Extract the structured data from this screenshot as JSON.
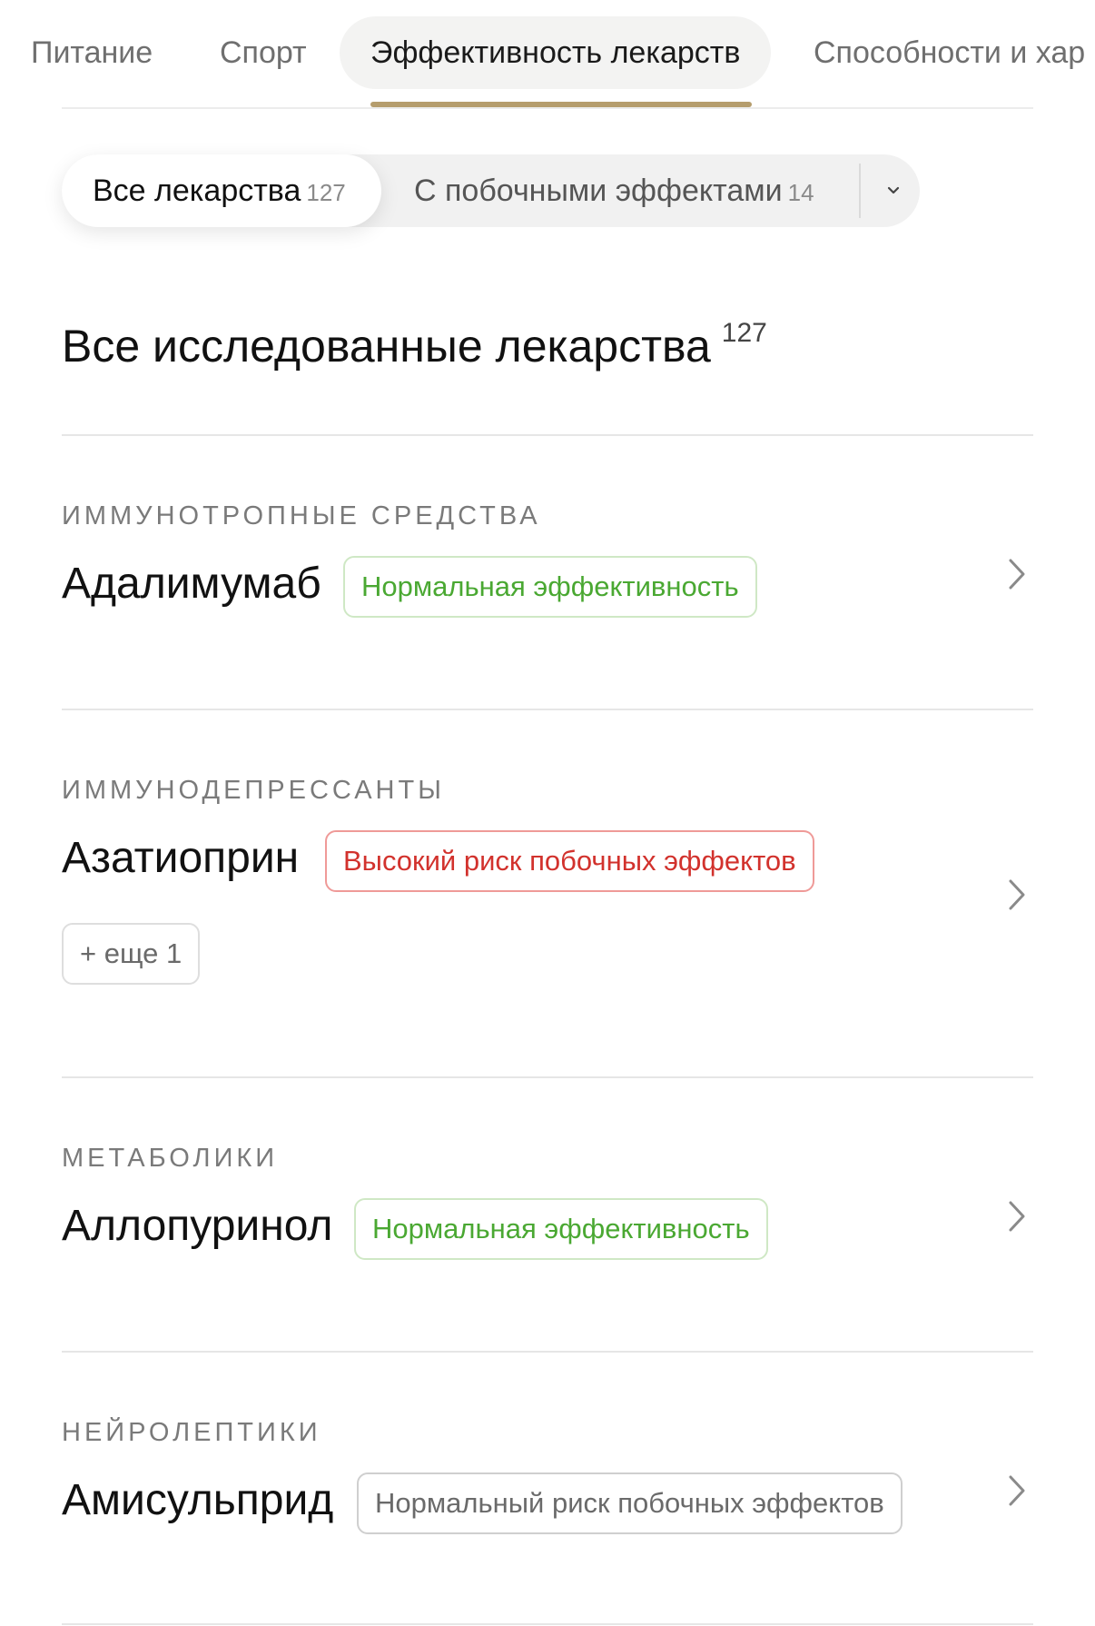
{
  "tabs": [
    {
      "label": "Питание",
      "active": false
    },
    {
      "label": "Спорт",
      "active": false
    },
    {
      "label": "Эффективность лекарств",
      "active": true
    },
    {
      "label": "Способности и хар",
      "active": false
    }
  ],
  "filter": {
    "all": {
      "label": "Все лекарства",
      "count": "127"
    },
    "side_effects": {
      "label": "С побочными эффектами",
      "count": "14"
    },
    "dropdown_icon": "chevron-down-icon"
  },
  "section": {
    "title": "Все исследованные лекарства",
    "count": "127"
  },
  "drugs": [
    {
      "category": "ИММУНОТРОПНЫЕ СРЕДСТВА",
      "name": "Адалимумаб",
      "badge": "Нормальная эффективность",
      "badge_type": "green",
      "more": ""
    },
    {
      "category": "ИММУНОДЕПРЕССАНТЫ",
      "name": "Азатиоприн",
      "badge": "Высокий риск побочных эффектов",
      "badge_type": "red",
      "more": "+ еще 1"
    },
    {
      "category": "МЕТАБОЛИКИ",
      "name": "Аллопуринол",
      "badge": "Нормальная эффективность",
      "badge_type": "green",
      "more": ""
    },
    {
      "category": "НЕЙРОЛЕПТИКИ",
      "name": "Амисульприд",
      "badge": "Нормальный риск побочных эффектов",
      "badge_type": "gray",
      "more": ""
    }
  ],
  "colors": {
    "accent_underline": "#b59d6d",
    "badge_green": "#4aa832",
    "badge_red": "#d2322d",
    "badge_gray": "#6a6a6a"
  },
  "icons": {
    "row_chevron": "chevron-right-icon"
  }
}
